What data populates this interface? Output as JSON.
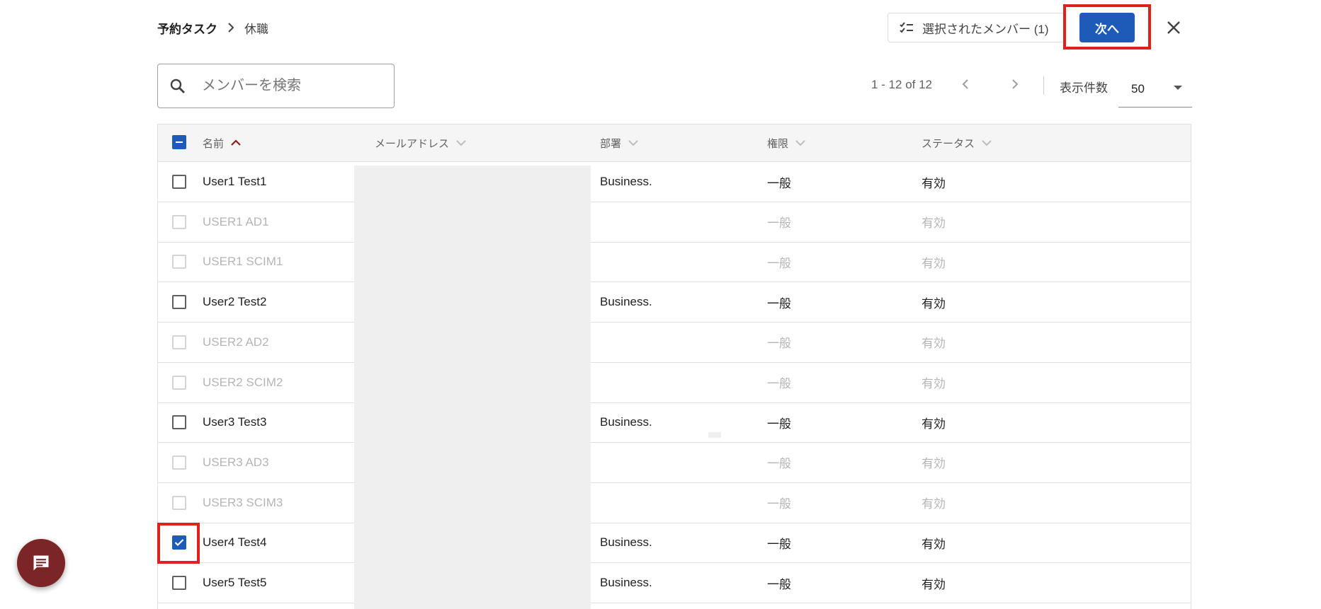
{
  "header": {
    "breadcrumb_parent": "予約タスク",
    "breadcrumb_current": "休職",
    "selected_members_label": "選択されたメンバー (1)",
    "next_label": "次へ"
  },
  "search": {
    "placeholder": "メンバーを検索",
    "value": ""
  },
  "pagination": {
    "range": "1 - 12 of 12",
    "per_page_label": "表示件数",
    "per_page_value": "50"
  },
  "table": {
    "columns": [
      "名前",
      "メールアドレス",
      "部署",
      "権限",
      "ステータス"
    ],
    "rows": [
      {
        "name": "User1 Test1",
        "dept": "Business.",
        "role": "一般",
        "status": "有効",
        "disabled": false,
        "checked": false
      },
      {
        "name": "USER1 AD1",
        "dept": "",
        "role": "一般",
        "status": "有効",
        "disabled": true,
        "checked": false
      },
      {
        "name": "USER1 SCIM1",
        "dept": "",
        "role": "一般",
        "status": "有効",
        "disabled": true,
        "checked": false
      },
      {
        "name": "User2 Test2",
        "dept": "Business.",
        "role": "一般",
        "status": "有効",
        "disabled": false,
        "checked": false
      },
      {
        "name": "USER2 AD2",
        "dept": "",
        "role": "一般",
        "status": "有効",
        "disabled": true,
        "checked": false
      },
      {
        "name": "USER2 SCIM2",
        "dept": "",
        "role": "一般",
        "status": "有効",
        "disabled": true,
        "checked": false
      },
      {
        "name": "User3 Test3",
        "dept": "Business.",
        "role": "一般",
        "status": "有効",
        "disabled": false,
        "checked": false
      },
      {
        "name": "USER3 AD3",
        "dept": "",
        "role": "一般",
        "status": "有効",
        "disabled": true,
        "checked": false
      },
      {
        "name": "USER3 SCIM3",
        "dept": "",
        "role": "一般",
        "status": "有効",
        "disabled": true,
        "checked": false
      },
      {
        "name": "User4 Test4",
        "dept": "Business.",
        "role": "一般",
        "status": "有効",
        "disabled": false,
        "checked": true
      },
      {
        "name": "User5 Test5",
        "dept": "Business.",
        "role": "一般",
        "status": "有効",
        "disabled": false,
        "checked": false
      }
    ]
  },
  "colors": {
    "primary": "#1e5bb8",
    "highlight": "#e0201c",
    "fab": "#7c2527",
    "sort_active": "#8b1d1d"
  }
}
